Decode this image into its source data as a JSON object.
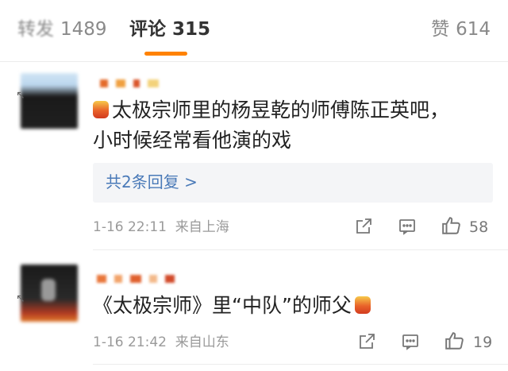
{
  "tabs": {
    "repost": {
      "label": "转发",
      "count": "1489"
    },
    "comment": {
      "label": "评论",
      "count": "315"
    },
    "like": {
      "label": "赞",
      "count": "614"
    }
  },
  "comments": [
    {
      "line1": "太极宗师里的杨昱乾的师傅陈正英吧，",
      "line2": "小时候经常看他演的戏",
      "reply_link": "共2条回复 >",
      "time": "1-16 22:11",
      "location": "来自上海",
      "like_count": "58"
    },
    {
      "line1": "《太极宗师》里“中队”的师父",
      "time": "1-16 21:42",
      "location": "来自山东",
      "like_count": "19"
    }
  ],
  "icons": {
    "share": "share-icon",
    "comment": "comment-icon",
    "like": "thumbs-up-icon",
    "emoji": "candle-emoji-icon"
  },
  "colors": {
    "accent": "#ff8200",
    "link": "#4a7ab8"
  }
}
